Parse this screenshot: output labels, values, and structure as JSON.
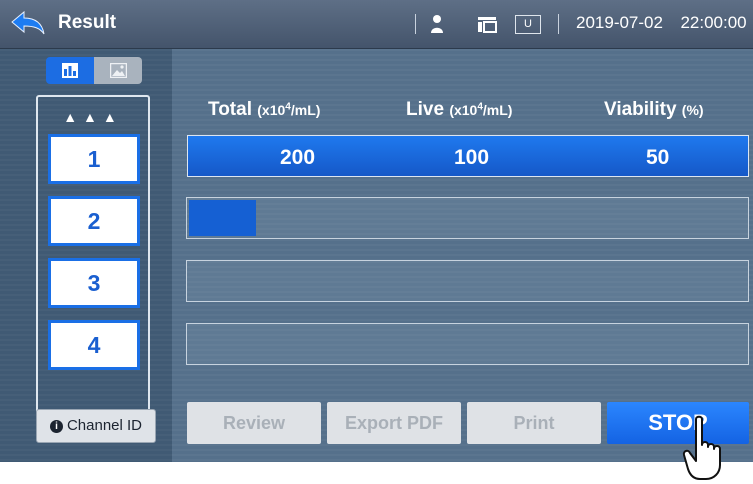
{
  "header": {
    "title": "Result",
    "usb_label": "U",
    "date": "2019-07-02",
    "time": "22:00:00",
    "icons": [
      "back-arrow-icon",
      "user-icon",
      "memory-icon",
      "usb-icon"
    ]
  },
  "sidebar": {
    "view_modes": [
      "chart-icon",
      "image-icon"
    ],
    "active_view": "chart",
    "arrows": "▲▲▲",
    "channels": [
      "1",
      "2",
      "3",
      "4"
    ],
    "channel_id_label": "Channel ID"
  },
  "results": {
    "total_label": "Total",
    "total_unit_prefix": "(x10",
    "total_unit_sup": "4",
    "total_unit_suffix": "/mL)",
    "live_label": "Live",
    "live_unit_prefix": "(x10",
    "live_unit_sup": "4",
    "live_unit_suffix": "/mL)",
    "viability_label": "Viability",
    "viability_unit": "(%)",
    "total_value": "200",
    "live_value": "100",
    "viability_value": "50"
  },
  "progress": {
    "channel_1": 0.12,
    "channel_2": 0,
    "channel_3": 0,
    "channel_4": 0
  },
  "actions": {
    "review": "Review",
    "export_pdf": "Export PDF",
    "print": "Print",
    "stop": "STOP"
  },
  "colors": {
    "accent": "#1a6fe6",
    "topbar": "#4e5f77",
    "panel": "#55708b",
    "disabled_button": "#dfe2e6"
  }
}
